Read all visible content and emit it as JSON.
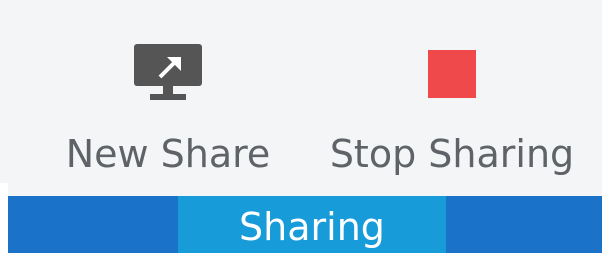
{
  "toolbar": {
    "buttons": [
      {
        "label": "New Share",
        "icon": "monitor-share-icon"
      },
      {
        "label": "Stop Sharing",
        "icon": "stop-square-icon"
      }
    ]
  },
  "status_bar": {
    "active_tab": "Sharing"
  },
  "colors": {
    "toolbar_background": "#f4f5f7",
    "label_text": "#5f6368",
    "monitor_icon": "#555555",
    "stop_icon": "#f0494b",
    "status_bar": "#1a73c9",
    "status_tab": "#189bd9"
  }
}
